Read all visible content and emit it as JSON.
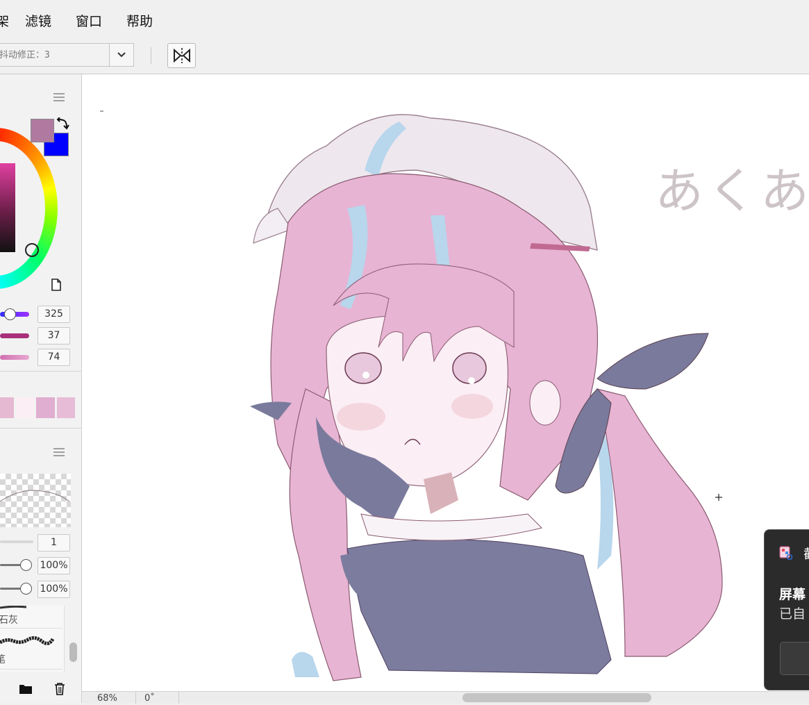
{
  "menu": {
    "items": [
      {
        "label": "滤镜"
      },
      {
        "label": "窗口"
      },
      {
        "label": "帮助"
      }
    ],
    "partial_item": "架"
  },
  "toolbar": {
    "stabilizer_text": "抖动修正：3",
    "dropdown_icon": "chevron-down-icon",
    "mirror_icon": "flip-horizontal-icon"
  },
  "color_panel": {
    "foreground_color": "#b07aa0",
    "background_color": "#0000ff",
    "values": {
      "hue": "325",
      "saturation": "37",
      "value": "74"
    },
    "swatches": [
      "#e5b9d1",
      "#fbeef5",
      "#e0aed0",
      "#e7bcd6"
    ]
  },
  "layer_panel": {
    "brush_size": "1",
    "opacity": "100%",
    "density": "100%"
  },
  "brushes": {
    "items": [
      {
        "label": "石灰"
      },
      {
        "label": "笔"
      }
    ]
  },
  "canvas": {
    "handwriting": "あくあ"
  },
  "status": {
    "zoom": "68%",
    "rotation": "0˚"
  },
  "toast": {
    "title": "截",
    "line1": "屏幕",
    "line2": "已自"
  }
}
